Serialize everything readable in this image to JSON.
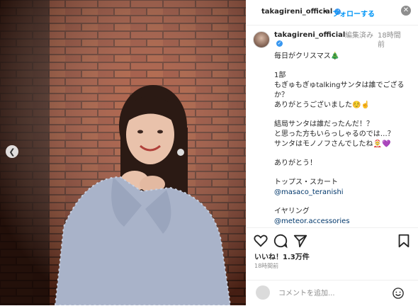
{
  "post": {
    "username": "takagireni_official",
    "follow_label": "フォローする",
    "dot": "•",
    "close_label": "✕"
  },
  "caption": {
    "username": "takagireni_official",
    "edited": "編集済み",
    "time_ago": "18時間前",
    "lines": [
      "毎日がクリスマス🎄",
      "",
      "1部",
      "もぎゅもぎゅtalkingサンタは誰でござるか？",
      "ありがとうございました☺️☝️",
      "",
      "結局サンタは誰だったんだ！？",
      "と思った方もいらっしゃるのでは…？",
      "サンタはモノノフさんでしたね🤶💜",
      "",
      "ありがとう！",
      "",
      "トップス・スカート",
      "@masaco_teranishi",
      "",
      "イヤリング",
      "@meteor.accessories"
    ]
  },
  "actions": {
    "likes": "いいね！1.3万件",
    "timestamp": "18時間前"
  },
  "comment": {
    "placeholder": "コメントを追加..."
  },
  "icons": {
    "like": "heart-icon",
    "comment": "comment-icon",
    "share": "share-icon",
    "save": "bookmark-icon",
    "emoji": "smiley-icon",
    "prev": "chevron-left-icon"
  },
  "colors": {
    "accent": "#0095f6",
    "verified": "#3897f0",
    "link": "#00376b",
    "muted": "#8e8e8e"
  }
}
